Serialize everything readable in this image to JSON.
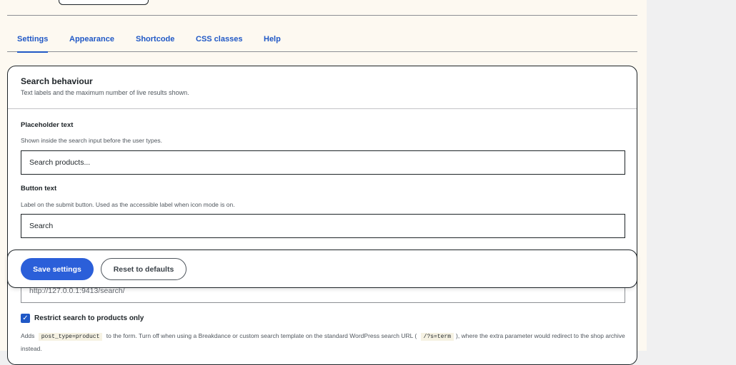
{
  "tabs": [
    {
      "label": "Settings"
    },
    {
      "label": "Appearance"
    },
    {
      "label": "Shortcode"
    },
    {
      "label": "CSS classes"
    },
    {
      "label": "Help"
    }
  ],
  "section": {
    "title": "Search behaviour",
    "description": "Text labels and the maximum number of live results shown."
  },
  "fields": {
    "placeholder": {
      "label": "Placeholder text",
      "help": "Shown inside the search input before the user types.",
      "value": "Search products..."
    },
    "button_text": {
      "label": "Button text",
      "help": "Label on the submit button. Used as the accessible label when icon mode is on.",
      "value": "Search"
    },
    "search_url": {
      "value": "http://127.0.0.1:9413/search/"
    }
  },
  "restrict": {
    "checked": true,
    "label": "Restrict search to products only",
    "desc_part1": "Adds",
    "code1": "post_type=product",
    "desc_part2": "to the form. Turn off when using a Breakdance or custom search template on the standard WordPress search URL (",
    "code2": "/?s=term",
    "desc_part3": "), where the extra parameter would redirect to the shop archive instead."
  },
  "actions": {
    "save_label": "Save settings",
    "reset_label": "Reset to defaults"
  },
  "colors": {
    "accent": "#2058c6",
    "primary_button": "#2b5fd9",
    "page_background": "#fdf9f1",
    "sidebar_background": "#f0f0f1"
  }
}
